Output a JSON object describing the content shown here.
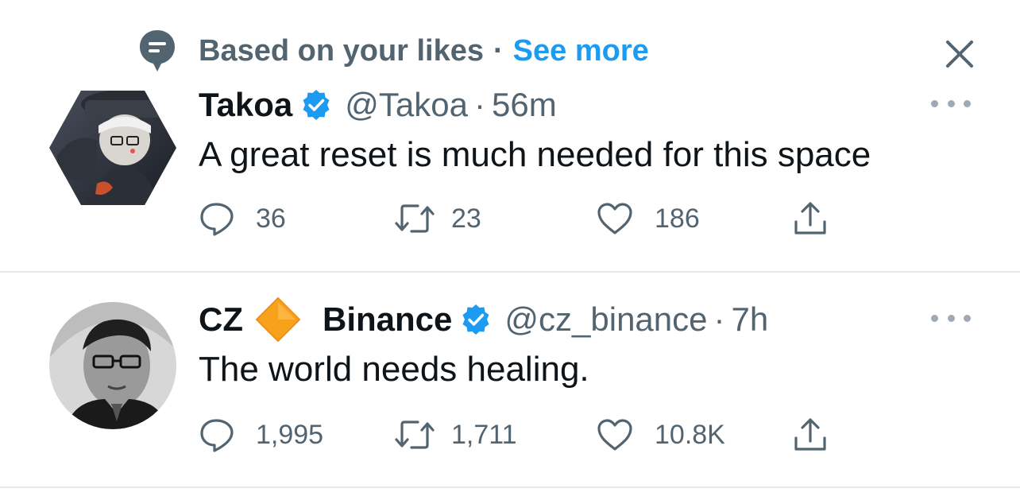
{
  "context": {
    "icon": "speech-bubble-icon",
    "text": "Based on your likes",
    "separator": "·",
    "link": "See more"
  },
  "close_icon": "close-icon",
  "tweets": [
    {
      "display_name": "Takoa",
      "handle": "@Takoa",
      "separator": "·",
      "time": "56m",
      "text": "A great reset is much needed for this space",
      "avatar": "hexagon-nft-avatar",
      "verified": true,
      "counts": {
        "replies": "36",
        "retweets": "23",
        "likes": "186"
      }
    },
    {
      "display_name": "CZ",
      "display_name_2": "Binance",
      "emoji": "orange-diamond-icon",
      "handle": "@cz_binance",
      "separator": "·",
      "time": "7h",
      "text": "The world needs healing.",
      "avatar": "round-photo-avatar",
      "verified": true,
      "counts": {
        "replies": "1,995",
        "retweets": "1,711",
        "likes": "10.8K"
      }
    }
  ],
  "colors": {
    "accent": "#1d9bf0",
    "secondary_text": "#536471",
    "primary_text": "#0f1419",
    "divider": "#e6e9ec",
    "diamond": "#f7a21b"
  }
}
